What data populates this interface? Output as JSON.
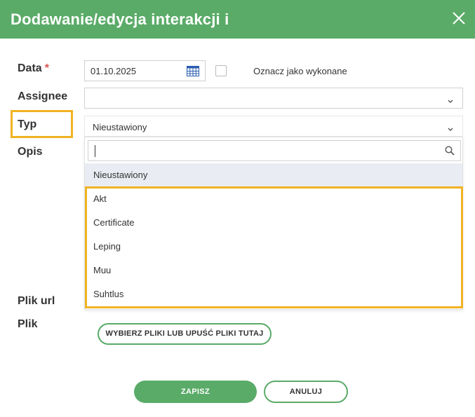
{
  "header": {
    "title": "Dodawanie/edycja interakcji i"
  },
  "form": {
    "date_label": "Data",
    "required_mark": "*",
    "date_value": "01.10.2025",
    "done_label": "Oznacz jako wykonane",
    "done_checked": false,
    "assignee_label": "Assignee",
    "assignee_value": "",
    "type_label": "Typ",
    "type_value": "Nieustawiony",
    "description_label": "Opis",
    "file_url_label": "Plik url",
    "file_label": "Plik",
    "upload_button": "WYBIERZ PLIKI LUB UPUŚĆ PLIKI TUTAJ"
  },
  "dropdown": {
    "search_value": "",
    "items": [
      {
        "label": "Nieustawiony",
        "selected": true
      },
      {
        "label": "Akt"
      },
      {
        "label": "Certificate"
      },
      {
        "label": "Leping"
      },
      {
        "label": "Muu"
      },
      {
        "label": "Suhtlus"
      }
    ]
  },
  "footer": {
    "save_label": "ZAPISZ",
    "cancel_label": "ANULUJ"
  },
  "colors": {
    "brand_green": "#5aab68",
    "highlight": "#f0b323",
    "required": "#d9534f",
    "calendar_icon": "#2a5db0"
  }
}
